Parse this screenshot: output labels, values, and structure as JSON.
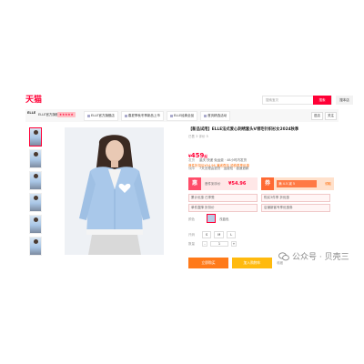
{
  "header": {
    "logo": "天猫",
    "search_placeholder": "搜索宝贝",
    "search_button": "搜索",
    "search_shop_button": "搜本店"
  },
  "shop": {
    "logo_text": "ELLE",
    "name": "ELLE官方旗舰店",
    "rating": "★★★★★",
    "tabs": [
      "ELLE官方旗舰店",
      "春夏季秋冬季新品上市",
      "ELLE经典全品",
      "首页精选活动"
    ],
    "actions": [
      "进店",
      "关注"
    ]
  },
  "product": {
    "title": "【新品试用】ELLE法式爱心刺绣套头V领毛针织衫女2024秋季",
    "meta": "已售 3   评价 5",
    "currency": "¥",
    "price": "459",
    "price_suffix": "起",
    "promo": "首件折扣后¥54.96 满减叠加 领券再享优惠",
    "shipping_label": "发货",
    "shipping_value": "重庆 快递 免运费 · 48小时内发货",
    "guarantee_label": "保障",
    "guarantee_value": "7天无理由退货 · 运费险 · 极速退款",
    "coupon_left_tag": "惠",
    "coupon_left_text": "首件到手价",
    "coupon_left_value": "¥54.96",
    "coupon_right_tag": "券",
    "coupon_right_body": "满 4.5 减 5",
    "coupon_right_claim": "领取",
    "chips": [
      [
        "累计优惠 已享受",
        "购买3件享 折优惠"
      ],
      [
        "单件直降 折扣价",
        "店铺新客专享优惠券"
      ]
    ],
    "color_label": "颜色",
    "color_value": "浅蓝色",
    "sizes_label": "尺码",
    "sizes": [
      "S",
      "M",
      "L"
    ],
    "qty_label": "数量",
    "qty_minus": "-",
    "qty_value": "1",
    "qty_plus": "+",
    "buy_now": "立即购买",
    "add_cart": "加入购物车",
    "favorite": "收藏"
  },
  "watermark": "公众号 · 贝壳三",
  "colors": {
    "brand": "#ff0036",
    "orange": "#ff7a1a",
    "yellow": "#ffba0e"
  }
}
